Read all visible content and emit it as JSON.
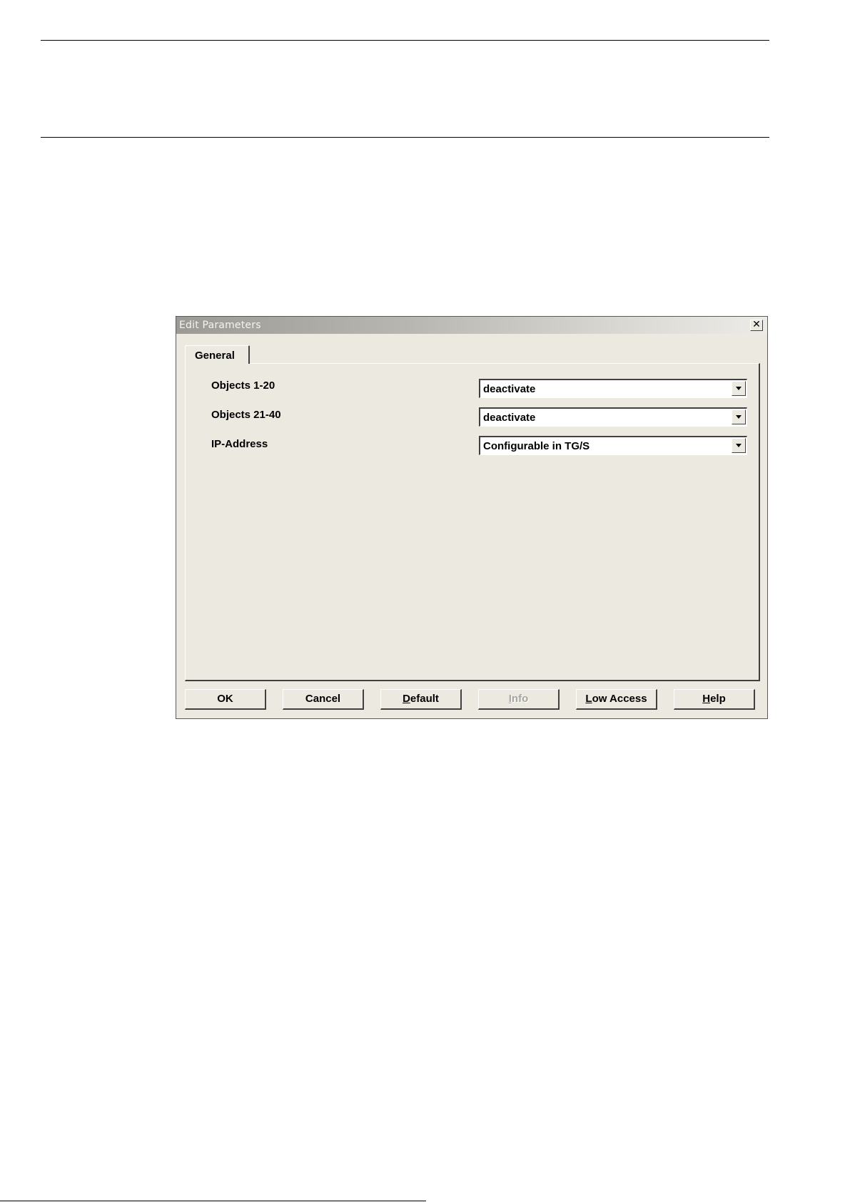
{
  "dialog": {
    "title": "Edit Parameters",
    "close_glyph": "✕",
    "tab": {
      "label": "General"
    },
    "params": [
      {
        "label": "Objects 1-20",
        "value": "deactivate"
      },
      {
        "label": "Objects 21-40",
        "value": "deactivate"
      },
      {
        "label": "IP-Address",
        "value": "Configurable in TG/S"
      }
    ],
    "buttons": {
      "ok": "OK",
      "cancel": "Cancel",
      "default_acc": "D",
      "default_rest": "efault",
      "info_acc": "I",
      "info_rest": "nfo",
      "low_access_acc": "L",
      "low_access_rest": "ow Access",
      "help_acc": "H",
      "help_rest": "elp"
    },
    "info_disabled": true
  }
}
